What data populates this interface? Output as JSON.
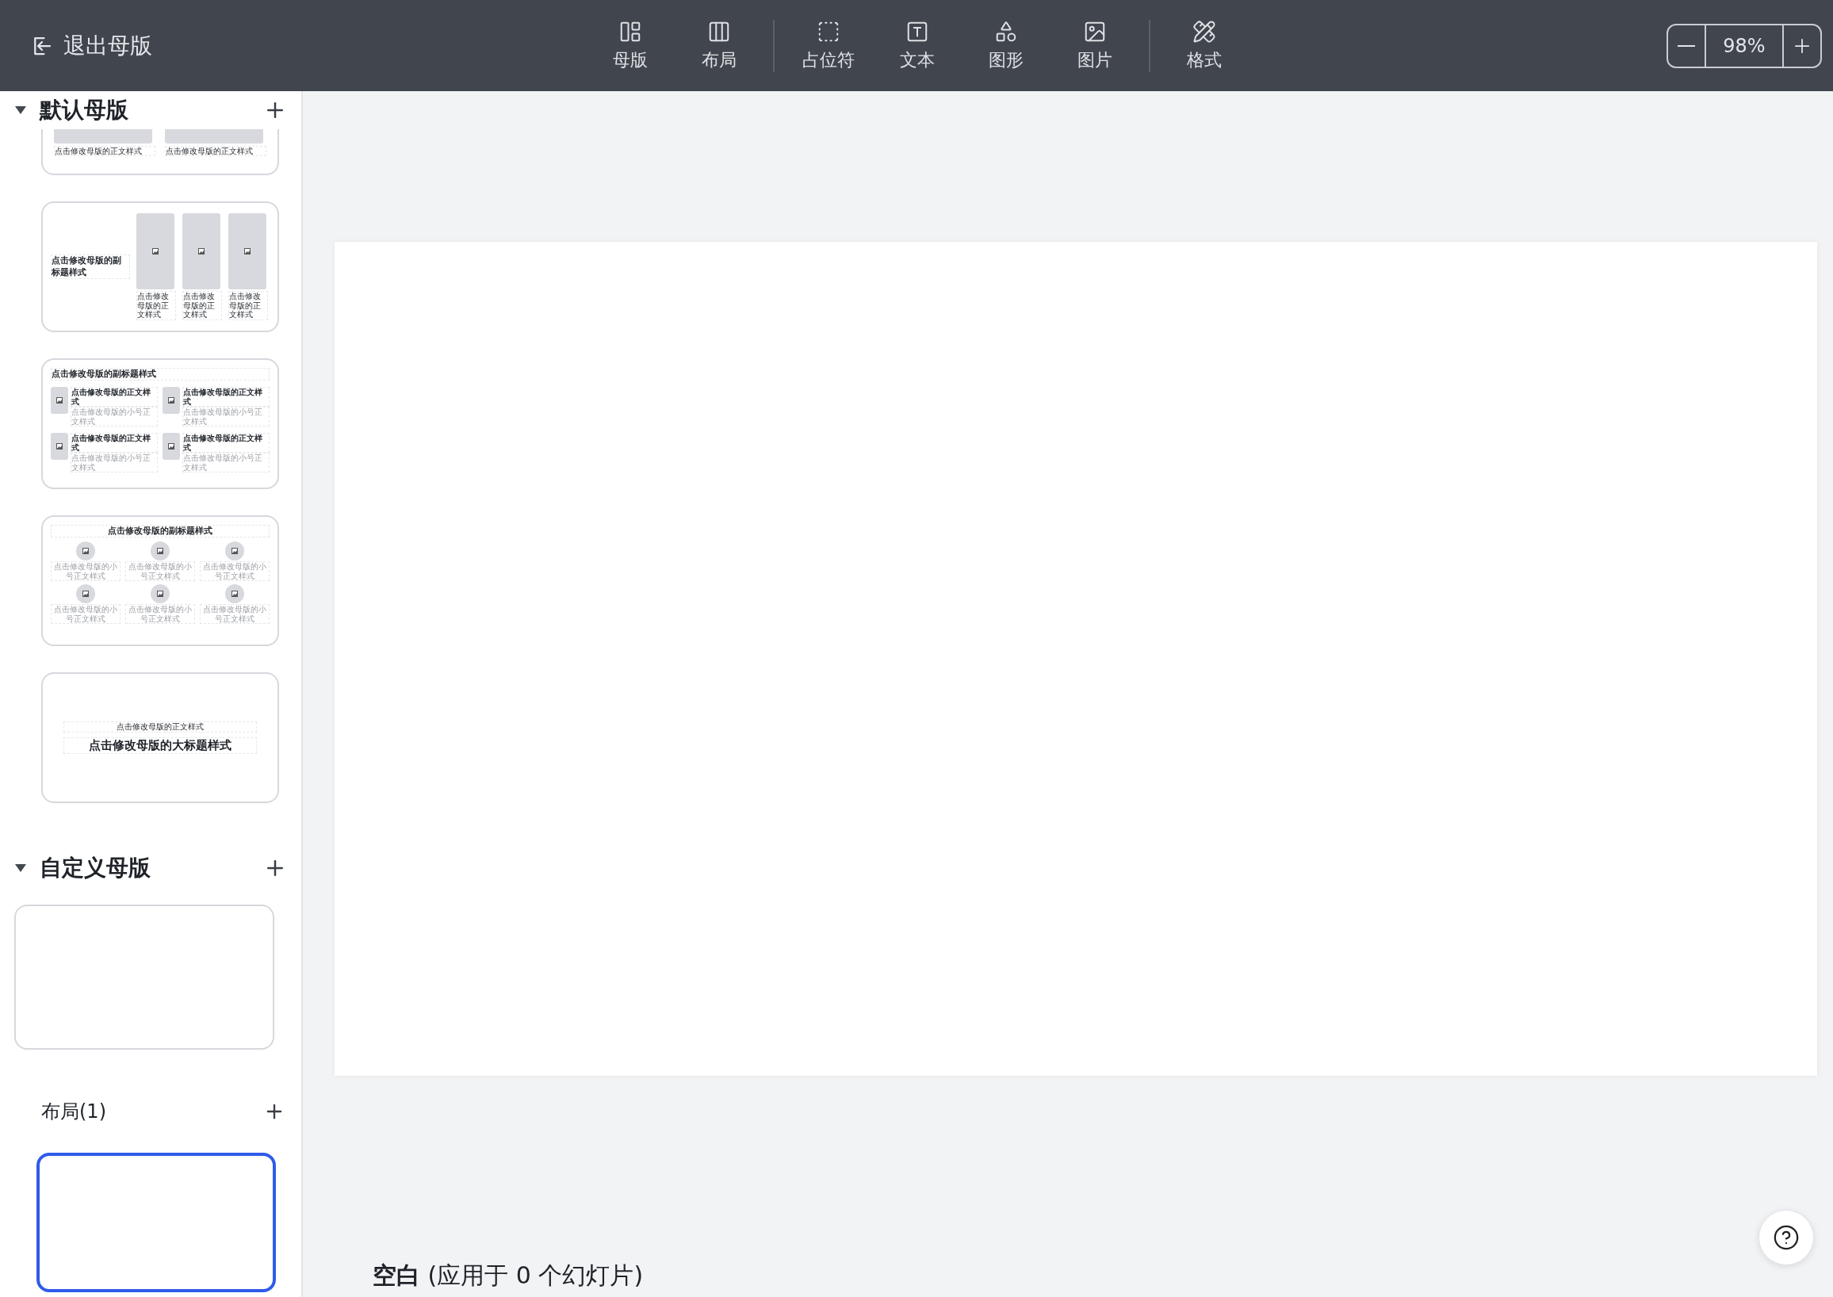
{
  "toolbar": {
    "exit_label": "退出母版",
    "groups": [
      [
        {
          "label": "母版",
          "kind": "master"
        },
        {
          "label": "布局",
          "kind": "layout"
        }
      ],
      [
        {
          "label": "占位符",
          "kind": "placeholder"
        },
        {
          "label": "文本",
          "kind": "text"
        },
        {
          "label": "图形",
          "kind": "shape"
        },
        {
          "label": "图片",
          "kind": "image"
        }
      ],
      [
        {
          "label": "格式",
          "kind": "format"
        }
      ]
    ],
    "zoom": {
      "value": "98%"
    }
  },
  "sidebar": {
    "sections": [
      {
        "title": "默认母版",
        "expanded": true,
        "masters": [
          {
            "kind": "two-pictures",
            "selected": false,
            "captions": [
              "点击修改母版的正文样式",
              "点击修改母版的正文样式"
            ]
          },
          {
            "kind": "three-columns",
            "selected": false,
            "title": "点击修改母版的副标题样式",
            "captions": [
              "点击修改母版的正文样式",
              "点击修改母版的正文样式",
              "点击修改母版的正文样式"
            ]
          },
          {
            "kind": "grid-four",
            "selected": false,
            "title": "点击修改母版的副标题样式",
            "items": [
              {
                "heading": "点击修改母版的正文样式",
                "text": "点击修改母版的小号正文样式"
              },
              {
                "heading": "点击修改母版的正文样式",
                "text": "点击修改母版的小号正文样式"
              },
              {
                "heading": "点击修改母版的正文样式",
                "text": "点击修改母版的小号正文样式"
              },
              {
                "heading": "点击修改母版的正文样式",
                "text": "点击修改母版的小号正文样式"
              }
            ]
          },
          {
            "kind": "circles-six",
            "selected": false,
            "title": "点击修改母版的副标题样式",
            "captions": [
              "点击修改母版的小号正文样式",
              "点击修改母版的小号正文样式",
              "点击修改母版的小号正文样式",
              "点击修改母版的小号正文样式",
              "点击修改母版的小号正文样式",
              "点击修改母版的小号正文样式"
            ]
          },
          {
            "kind": "title",
            "selected": false,
            "subtitle": "点击修改母版的正文样式",
            "title": "点击修改母版的大标题样式"
          }
        ]
      },
      {
        "title": "自定义母版",
        "expanded": true,
        "masters": [
          {
            "selected": false
          }
        ],
        "layouts_heading": "布局(1)",
        "layouts": [
          {
            "selected": true
          }
        ]
      }
    ]
  },
  "canvas": {
    "caption": "**空白** (应用于 0 个幻灯片)"
  }
}
